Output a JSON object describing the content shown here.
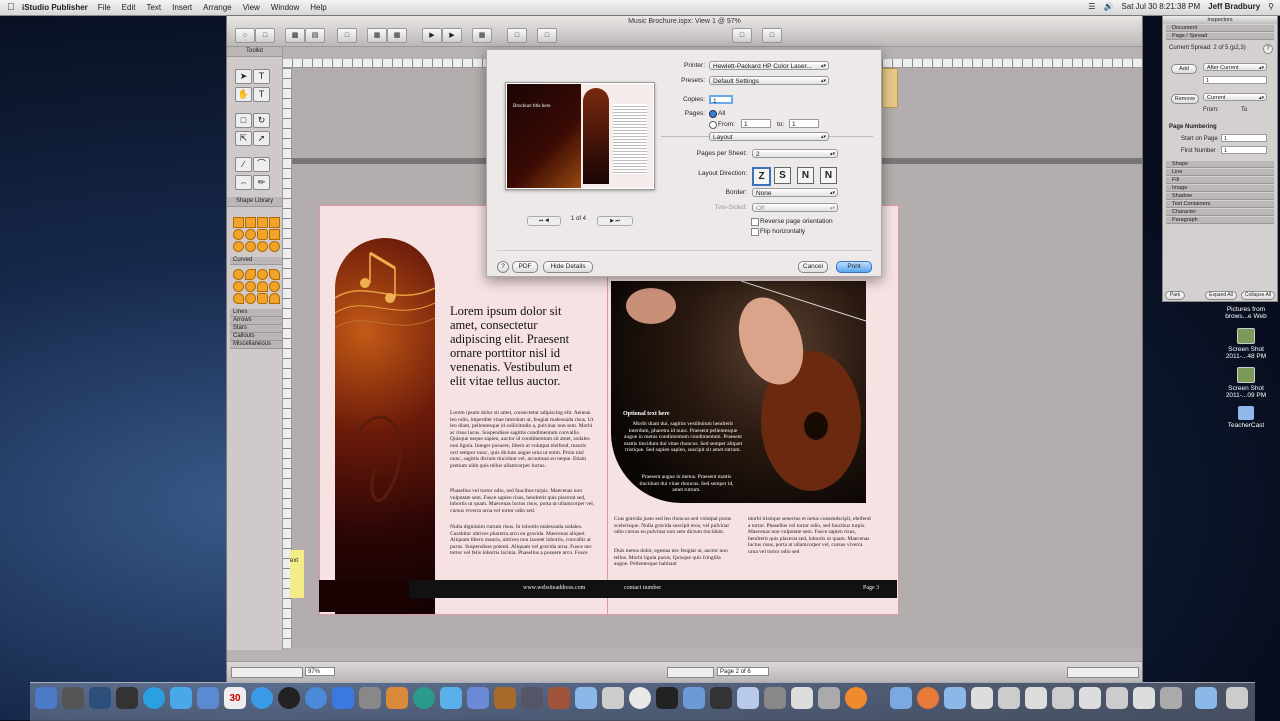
{
  "menubar": {
    "app": "iStudio Publisher",
    "items": [
      "File",
      "Edit",
      "Text",
      "Insert",
      "Arrange",
      "View",
      "Window",
      "Help"
    ],
    "clock": "Sat Jul 30  8:21:38 PM",
    "user": "Jeff Bradbury"
  },
  "window": {
    "title": "Music Brochure.ispx: View 1 @ 97%"
  },
  "toolkit": {
    "title": "Toolkit",
    "shape_library": "Shape Library",
    "categories": [
      "Curved",
      "Lines",
      "Arrows",
      "Stars",
      "Callouts",
      "Miscellaneous"
    ]
  },
  "print_dialog": {
    "printer_label": "Printer:",
    "printer_value": "Hewlett-Packard HP Color Laser...",
    "presets_label": "Presets:",
    "presets_value": "Default Settings",
    "copies_label": "Copies:",
    "copies_value": "1",
    "pages_label": "Pages:",
    "pages_all": "All",
    "from_label": "From:",
    "from_value": "1",
    "to_label": "to:",
    "to_value": "1",
    "section_value": "Layout",
    "pages_per_sheet_label": "Pages per Sheet:",
    "pages_per_sheet_value": "2",
    "layout_direction_label": "Layout Direction:",
    "border_label": "Border:",
    "border_value": "None",
    "two_sided_label": "Two-Sided:",
    "two_sided_value": "Off",
    "reverse_label": "Reverse page orientation",
    "flip_label": "Flip horizontally",
    "page_counter": "1 of 4",
    "help": "?",
    "pdf": "PDF",
    "hide_details": "Hide Details",
    "cancel": "Cancel",
    "print": "Print",
    "thumb_heading": "Brochure title here"
  },
  "brochure": {
    "headline": "Lorem ipsum dolor sit amet, consectetur adipiscing elit. Praesent ornare porttitor nisl id venenatis. Vestibulum et elit vitae tellus auctor.",
    "body1": "Lorem ipsum dolor sit amet, consectetur adipiscing elit. Aenean leo odio, imperdiet vitae interdum ut, feugiat malesuada risus. Ut leo diam, pellentesque id sollicitudin a, pulvinar non sem. Morbi ac risus lacus. Suspendisse sagittis condimentum convallis. Quisque neque sapien, auctor id condimentum sit amet, sodales non ligula. Integer posuere, libero at volutpat eleifend, mauris orci tempor nunc, quis dictum augue urna ut enim. Proin nisl nunc, sagittis dictum tincidunt vel, accumsan eu neque. Etiam pretium nibh quis tellus ullamcorper luctus.",
    "body2": "Phasellus vel tortor odio, sed faucibus turpis. Maecenas non vulputate sem. Fusce sapien risus, hendrerit quis placerat sed, lobortis ut quam. Maecenas luctus risus, porta ut ullamcorper vel, cursus viverra urna vel tortor odio sed.",
    "body3": "Nulla dignissim rutrum risus. In lobortis malesuada sodales. Curabitur ultrices pharetra arcu eu gravida. Maecenas aliquet. Aliquam libero mauris, ultrices non laoreet lobortis, convallis at purus. Suspendisse potenti. Aliquam vel gravida urna. Fusce nec tortor vel felis lobortis lacinia. Phasellus a posuere arcu. Fusce",
    "optional_heading": "Optional text here",
    "optional_body": "Morbi diam dui, sagittis vestibulum hendrerit interdum, pharetra id nunc. Praesent pellentesque augue in metus condimentum condimentum. Praesent mattis tincidunt dui vitae rhoncus. Sed semper aliquet tristique. Sed sapien sapien, suscipit sit amet rutrum.",
    "optional_body2": "Praesent augue in metus. Praesent mattis tincidunt dui vitae rhoncus. Sed semper id, amet rutrum.",
    "col_a": "Cras gravida justo sed leo rhoncus sed volutpat purus scelerisque. Nulla gravida suscipit eros, vel pulvinar odio cursus eu pulvinar non sem dictum tincidunt.",
    "col_a2": "Duis metus dolor, egestas nec feugiat ut, auctor non tellus. Morbi ligula purus, Quisque quis fringilla augue. Pellentesque habitant",
    "col_b": "morbi tristique senectus et netus consendscipit, eleifend a tortor. Phasellus vel tortor odio, sed faucibus turpis. Maecenas non vulputate sem. Fusce sapien risus, hendrerit quis placerat sed, lobortis ut quam. Maecenas luctus risus, porta ut ullamcorper vel, cursus viverra urna vel tortor odio sed",
    "footer_web": "www.websiteaddress.com",
    "footer_contact": "contact number",
    "footer_page": "Page 3",
    "sticky": "ext"
  },
  "statusbar": {
    "zoom": "97%",
    "page": "Page 2 of 6"
  },
  "inspector": {
    "title": "Inspectors",
    "rows_top": [
      "Document",
      "Page / Spread"
    ],
    "current_spread": "Current Spread: 2 of 5 (p2,3)",
    "add": "Add",
    "after_current": "After Current",
    "add_count": "1",
    "remove": "Remove",
    "current": "Current",
    "from": "From:",
    "to": "To",
    "page_numbering": "Page Numbering",
    "start_on_page": "Start on Page",
    "start_value": "1",
    "first_number": "First Number",
    "first_value": "1",
    "rows": [
      "Shape",
      "Line",
      "Fill",
      "Image",
      "Shadow",
      "Text Containers",
      "Character",
      "Paragraph"
    ],
    "park": "Park",
    "expand_all": "Expand All",
    "collapse_all": "Collapse All"
  },
  "desktop": {
    "icons": [
      {
        "label": "Pictures from brows...e Web"
      },
      {
        "label": "Screen Shot 2011-...48 PM"
      },
      {
        "label": "Screen Shot 2011-...09 PM"
      },
      {
        "label": "TeacherCast"
      }
    ]
  },
  "dock": {
    "calendar_day": "30"
  }
}
